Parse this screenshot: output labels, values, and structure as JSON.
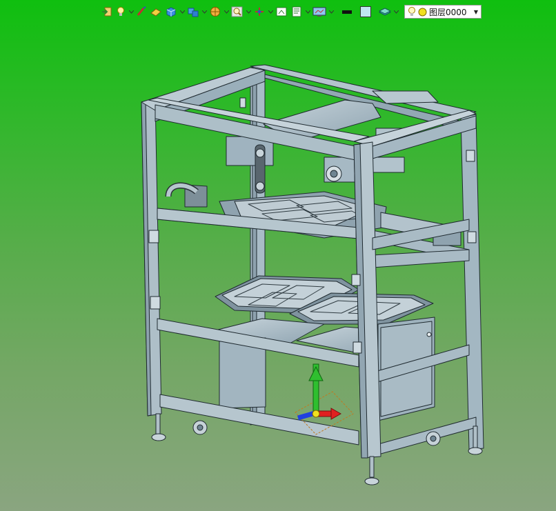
{
  "toolbar": {
    "tools": [
      {
        "icon": "import-icon",
        "has_dropdown": false
      },
      {
        "icon": "light-bulb-icon",
        "has_dropdown": true
      },
      {
        "icon": "brush-icon",
        "has_dropdown": false
      },
      {
        "icon": "eraser-icon",
        "has_dropdown": false
      },
      {
        "icon": "cube-icon",
        "has_dropdown": true
      },
      {
        "icon": "cube-stack-icon",
        "has_dropdown": true
      },
      {
        "icon": "section-view-icon",
        "has_dropdown": true
      },
      {
        "icon": "zoom-icon",
        "has_dropdown": true
      },
      {
        "icon": "move-axes-icon",
        "has_dropdown": true
      },
      {
        "icon": "fit-view-icon",
        "has_dropdown": false
      },
      {
        "icon": "panel-icon",
        "has_dropdown": true
      },
      {
        "icon": "display-mode-icon",
        "has_dropdown": true
      },
      {
        "icon": "line-color-icon",
        "has_dropdown": false
      },
      {
        "icon": "fill-color-icon",
        "has_dropdown": false
      },
      {
        "icon": "layer-stack-icon",
        "has_dropdown": true
      }
    ],
    "layer": {
      "label": "图层0000",
      "bulb_icon": "light-bulb-icon",
      "color_icon": "yellow-circle-icon"
    }
  },
  "viewport": {
    "background_top": "#0fbf0f",
    "background_bottom": "#8aa580",
    "model_color": "#9fb5c2",
    "edge_color": "#1f2a30",
    "triad_colors": {
      "x": "#e02020",
      "y": "#2fbf2f",
      "z": "#2040e0"
    }
  }
}
